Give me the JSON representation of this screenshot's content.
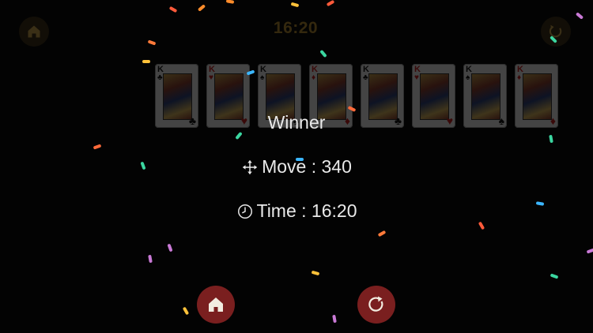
{
  "game": {
    "top_time": "16:20",
    "top_home_icon": "home-icon",
    "top_restart_icon": "restart-icon"
  },
  "foundation": [
    {
      "rank": "K",
      "suit": "♣",
      "color": "black"
    },
    {
      "rank": "K",
      "suit": "♥",
      "color": "red"
    },
    {
      "rank": "K",
      "suit": "♠",
      "color": "black"
    },
    {
      "rank": "K",
      "suit": "♦",
      "color": "red"
    },
    {
      "rank": "K",
      "suit": "♣",
      "color": "black"
    },
    {
      "rank": "K",
      "suit": "♥",
      "color": "red"
    },
    {
      "rank": "K",
      "suit": "♠",
      "color": "black"
    },
    {
      "rank": "K",
      "suit": "♦",
      "color": "red"
    }
  ],
  "result": {
    "title": "Winner",
    "move_label": "Move : 340",
    "time_label": "Time : 16:20",
    "move_icon": "move-arrows-icon",
    "time_icon": "clock-icon"
  },
  "buttons": {
    "home_icon": "home-icon",
    "restart_icon": "restart-icon"
  },
  "colors": {
    "background": "#030303",
    "button_fill": "#7a1f1f",
    "text": "#e9e9e9",
    "accent_gold": "#b28a2c"
  }
}
